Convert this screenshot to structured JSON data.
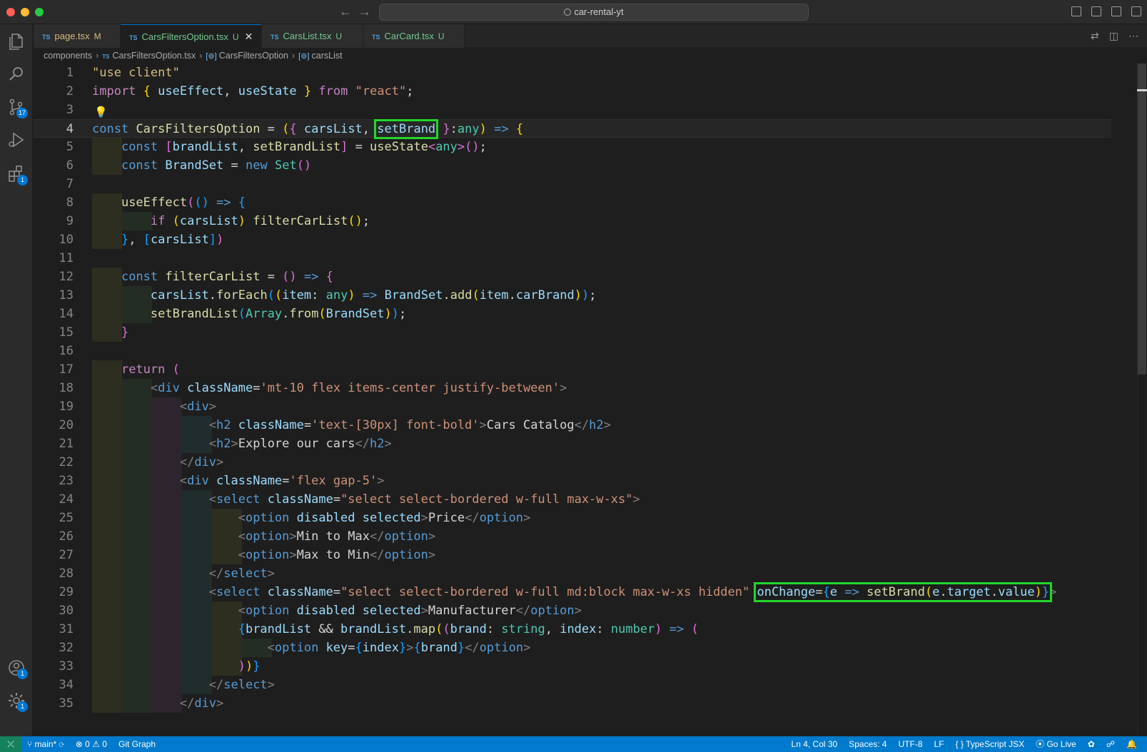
{
  "title": "car-rental-yt",
  "tabs": [
    {
      "label": "page.tsx",
      "status": "M",
      "active": false
    },
    {
      "label": "CarsFiltersOption.tsx",
      "status": "U",
      "active": true
    },
    {
      "label": "CarsList.tsx",
      "status": "U",
      "active": false
    },
    {
      "label": "CarCard.tsx",
      "status": "U",
      "active": false
    }
  ],
  "tab_lang": "TS",
  "breadcrumb": [
    "components",
    "CarsFiltersOption.tsx",
    "CarsFiltersOption",
    "carsList"
  ],
  "activity": {
    "scm_badge": "17",
    "extensions_badge": "1",
    "accounts_badge": "1",
    "settings_badge": "1"
  },
  "editor": {
    "current_line": 4,
    "line_numbers": [
      "1",
      "2",
      "3",
      "4",
      "5",
      "6",
      "7",
      "8",
      "9",
      "10",
      "11",
      "12",
      "13",
      "14",
      "15",
      "16",
      "17",
      "18",
      "19",
      "20",
      "21",
      "22",
      "23",
      "24",
      "25",
      "26",
      "27",
      "28",
      "29",
      "30",
      "31",
      "32",
      "33",
      "34",
      "35"
    ]
  },
  "status": {
    "branch": "main*",
    "errors": "0",
    "warnings": "0",
    "git_graph": "Git Graph",
    "position": "Ln 4, Col 30",
    "spaces": "Spaces: 4",
    "encoding": "UTF-8",
    "eol": "LF",
    "language": "TypeScript JSX",
    "golive": "Go Live"
  },
  "colors": {
    "statusbar": "#007acc",
    "highlight_box": "#21d62a",
    "editor_bg": "#1e1e1e"
  }
}
